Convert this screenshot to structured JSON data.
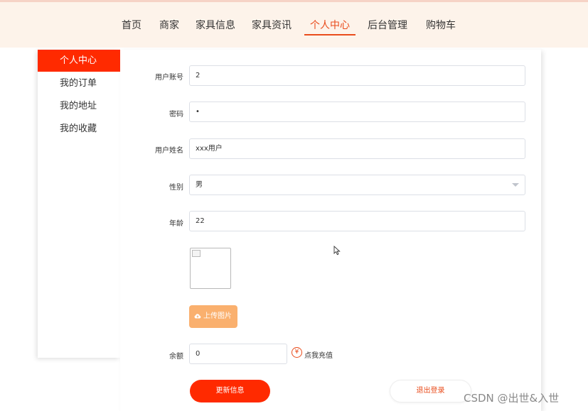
{
  "nav": {
    "items": [
      "首页",
      "商家",
      "家具信息",
      "家具资讯",
      "个人中心",
      "后台管理",
      "购物车"
    ],
    "active_index": 4
  },
  "sidebar": {
    "items": [
      "个人中心",
      "我的订单",
      "我的地址",
      "我的收藏"
    ],
    "active_index": 0
  },
  "form": {
    "account_label": "用户账号",
    "account_value": "2",
    "password_label": "密码",
    "password_value": "•",
    "name_label": "用户姓名",
    "name_value": "xxx用户",
    "gender_label": "性别",
    "gender_value": "男",
    "age_label": "年龄",
    "age_value": "22",
    "upload_label": "上传图片",
    "balance_label": "余额",
    "balance_value": "0",
    "recharge_label": "点我充值",
    "recharge_icon": "¥"
  },
  "actions": {
    "update_label": "更新信息",
    "logout_label": "退出登录"
  },
  "watermark": "CSDN @出世&入世",
  "colors": {
    "accent": "#ff2a00",
    "nav_active": "#e94c1c",
    "upload": "#fab06e",
    "topbar_bg": "#fdf3ea"
  }
}
